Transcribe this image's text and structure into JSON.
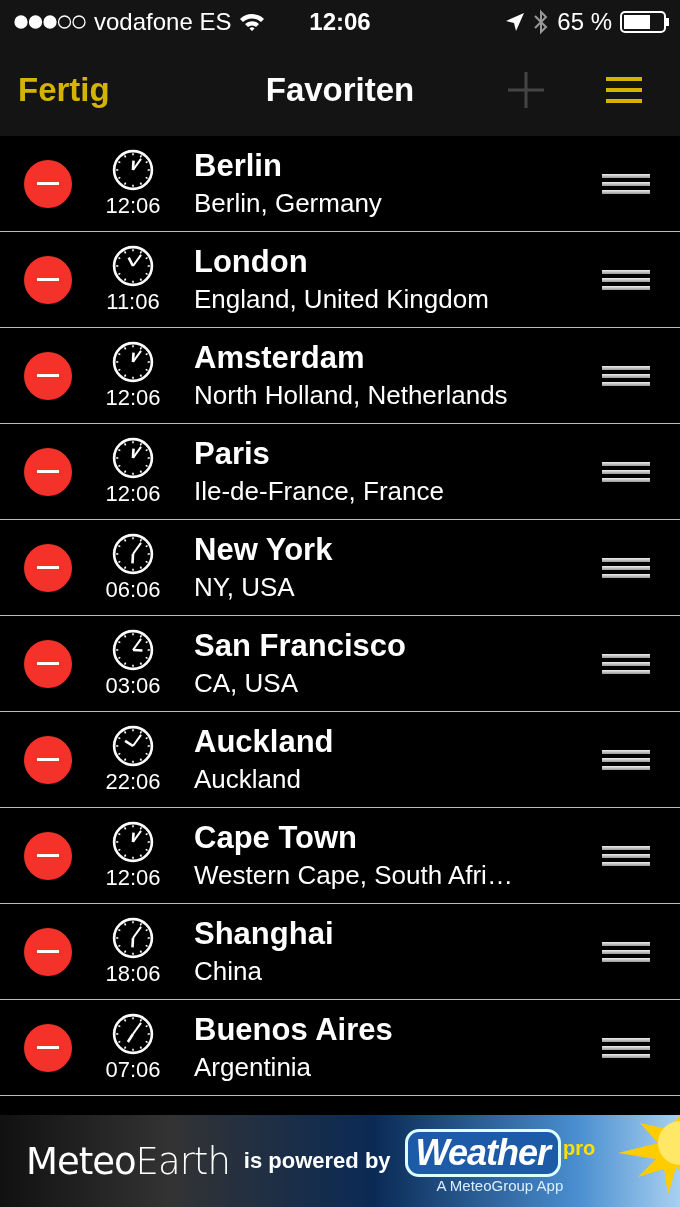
{
  "status_bar": {
    "carrier": "vodafone ES",
    "time": "12:06",
    "battery": "65 %"
  },
  "nav_bar": {
    "done": "Fertig",
    "title": "Favoriten"
  },
  "favorites": [
    {
      "name": "Berlin",
      "region": "Berlin, Germany",
      "time": "12:06"
    },
    {
      "name": "London",
      "region": "England, United Kingdom",
      "time": "11:06"
    },
    {
      "name": "Amsterdam",
      "region": "North Holland, Netherlands",
      "time": "12:06"
    },
    {
      "name": "Paris",
      "region": "Ile-de-France, France",
      "time": "12:06"
    },
    {
      "name": "New York",
      "region": "NY, USA",
      "time": "06:06"
    },
    {
      "name": "San Francisco",
      "region": "CA, USA",
      "time": "03:06"
    },
    {
      "name": "Auckland",
      "region": "Auckland",
      "time": "22:06"
    },
    {
      "name": "Cape Town",
      "region": "Western Cape, South Afri…",
      "time": "12:06"
    },
    {
      "name": "Shanghai",
      "region": "China",
      "time": "18:06"
    },
    {
      "name": "Buenos Aires",
      "region": "Argentinia",
      "time": "07:06"
    }
  ],
  "banner": {
    "app": "**Meteo**Earth",
    "powered": "is powered by",
    "brand": "Weather",
    "brand_tag": "pro",
    "tagline": "A MeteoGroup App"
  }
}
